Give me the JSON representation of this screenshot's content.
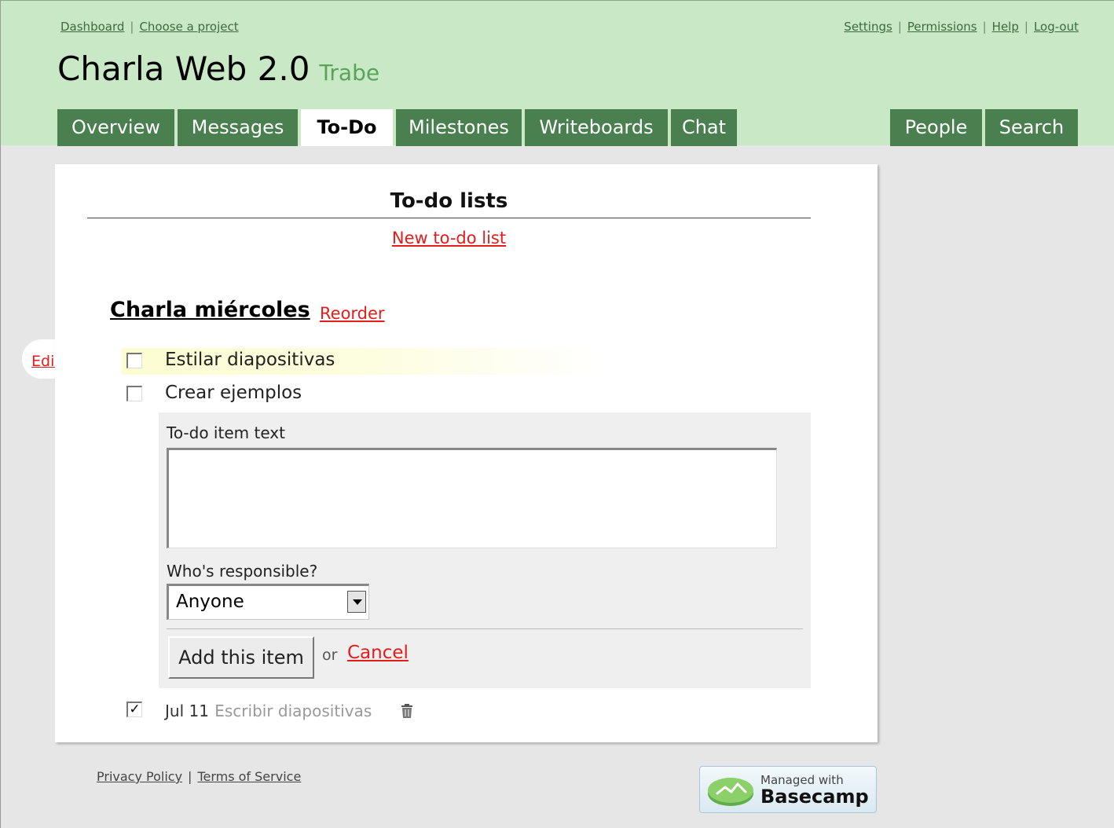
{
  "nav": {
    "left_links": [
      "Dashboard",
      "Choose a project"
    ],
    "right_links": [
      "Settings",
      "Permissions",
      "Help",
      "Log-out"
    ],
    "separator": "|"
  },
  "project": {
    "title": "Charla Web 2.0",
    "company": "Trabe"
  },
  "tabs": {
    "overview": "Overview",
    "messages": "Messages",
    "todo": "To-Do",
    "milestones": "Milestones",
    "writeboards": "Writeboards",
    "chat": "Chat",
    "people": "People",
    "search": "Search",
    "active": "To-Do"
  },
  "main": {
    "title": "To-do lists",
    "new_list_link": "New to-do list",
    "list": {
      "name": "Charla miércoles",
      "reorder_link": "Reorder",
      "edit_link": "Edit",
      "items": [
        {
          "text": "Estilar diapositivas",
          "checked": false
        },
        {
          "text": "Crear ejemplos",
          "checked": false
        }
      ],
      "completed": [
        {
          "date": "Jul 11",
          "text": "Escribir diapositivas",
          "checked": true
        }
      ]
    },
    "form": {
      "text_label": "To-do item text",
      "text_value": "",
      "responsible_label": "Who's responsible?",
      "responsible_value": "Anyone",
      "submit_label": "Add this item",
      "or_text": "or",
      "cancel_link": "Cancel"
    }
  },
  "footer": {
    "privacy": "Privacy Policy",
    "terms": "Terms of Service",
    "separator": "|",
    "badge_small": "Managed with",
    "badge_big": "Basecamp"
  },
  "colors": {
    "header_bg": "#c8e8c6",
    "tab_bg": "#4a7f4f",
    "link_red": "#e51c1c",
    "page_bg": "#e6e6e6"
  }
}
